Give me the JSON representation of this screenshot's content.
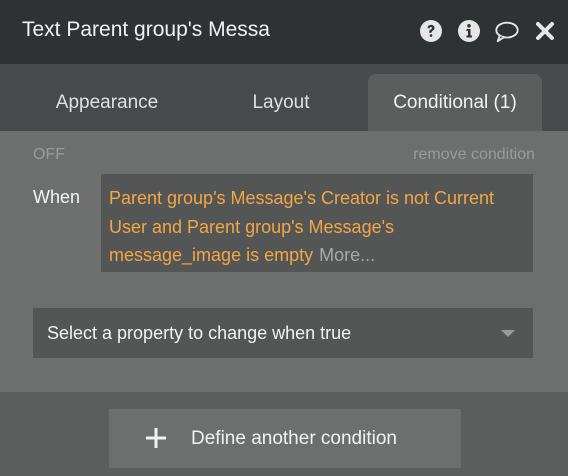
{
  "titlebar": {
    "title": "Text Parent group's Messa",
    "icons": [
      "help-icon",
      "info-icon",
      "comment-icon",
      "close-icon"
    ]
  },
  "tabs": [
    {
      "label": "Appearance",
      "active": false
    },
    {
      "label": "Layout",
      "active": false
    },
    {
      "label": "Conditional (1)",
      "active": true
    }
  ],
  "condition": {
    "status": "OFF",
    "remove_label": "remove condition",
    "when_label": "When",
    "expression": "Parent group's Message's Creator is not Current User and Parent group's Message's message_image is empty",
    "more_label": "More..."
  },
  "property_select": {
    "placeholder": "Select a property to change when true"
  },
  "define_button": {
    "label": "Define another condition"
  },
  "colors": {
    "titlebar_bg": "#2f3232",
    "expression_text": "#f4a646",
    "panel_bg": "#5c5e5e"
  }
}
